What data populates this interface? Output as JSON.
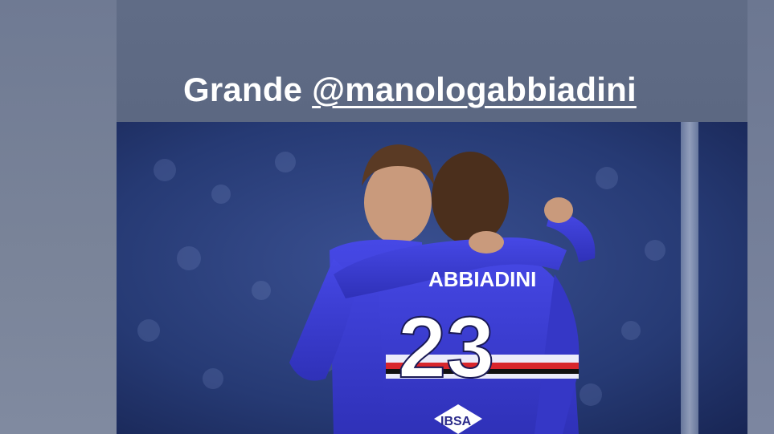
{
  "story": {
    "caption_prefix": "Grande ",
    "caption_mention": "@manologabbiadini",
    "photo": {
      "jersey_name": "ABBIADINI",
      "jersey_number": "23",
      "sponsor": "IBSA"
    }
  },
  "colors": {
    "background": "#6b7790",
    "kit_blue": "#3d3fd8",
    "stadium_blue": "#24366b",
    "caption_text": "#ffffff"
  }
}
